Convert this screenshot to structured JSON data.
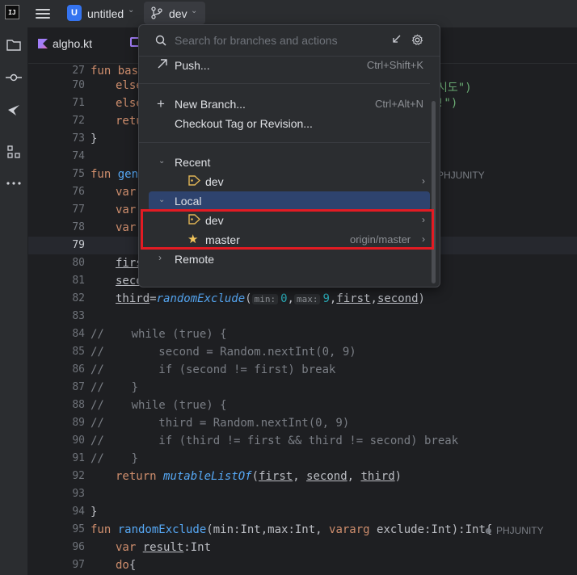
{
  "titlebar": {
    "project_badge": "U",
    "project_name": "untitled",
    "vcs_branch": "dev"
  },
  "tab": {
    "file_name": "algho.kt"
  },
  "gutter": [
    "27",
    "70",
    "71",
    "72",
    "73",
    "74",
    "75",
    "76",
    "77",
    "78",
    "79",
    "80",
    "81",
    "82",
    "83",
    "84",
    "85",
    "86",
    "87",
    "88",
    "89",
    "90",
    "91",
    "92",
    "93",
    "94",
    "95",
    "96",
    "97"
  ],
  "code": {
    "l27": "fun base",
    "l70_kw": "else",
    "l70_str": "시도\")",
    "l71_kw": "else",
    "l71_str": "!\")",
    "l72": "retu",
    "l73": "}",
    "l75_kw": "fun ",
    "l75_fn": "gene",
    "l75_author": "PHJUNITY",
    "l76": "var",
    "l77": "var",
    "l78": "var",
    "l80": "firs",
    "l81": "seco",
    "l82_a": "third",
    "l82_b": "=",
    "l82_fn": "randomExclude",
    "l82_c": "(",
    "l82_hint1": "min:",
    "l82_n1": "0",
    "l82_d": ",",
    "l82_hint2": "max:",
    "l82_n2": "9",
    "l82_e": ",",
    "l82_f": "first",
    "l82_g": ",",
    "l82_h": "second",
    "l82_i": ")",
    "l84": "//    while (true) {",
    "l85": "//        second = Random.nextInt(0, 9)",
    "l86": "//        if (second != first) break",
    "l87": "//    }",
    "l88": "//    while (true) {",
    "l89": "//        third = Random.nextInt(0, 9)",
    "l90": "//        if (third != first && third != second) break",
    "l91": "//    }",
    "l92_kw": "return ",
    "l92_fn": "mutableListOf",
    "l92_a": "(",
    "l92_b": "first",
    "l92_c": ", ",
    "l92_d": "second",
    "l92_e": ", ",
    "l92_f": "third",
    "l92_g": ")",
    "l94": "}",
    "l95_kw": "fun ",
    "l95_fn": "randomExclude",
    "l95_a": "(min:Int,max:Int, ",
    "l95_kw2": "vararg",
    "l95_b": " exclude:Int):Int{",
    "l95_author": "PHJUNITY",
    "l96_kw": "var ",
    "l96_a": "result",
    "l96_b": ":Int",
    "l97_kw": "do",
    "l97_a": "{"
  },
  "popup": {
    "search_placeholder": "Search for branches and actions",
    "push_label": "Push...",
    "push_shortcut": "Ctrl+Shift+K",
    "new_branch_label": "New Branch...",
    "new_branch_shortcut": "Ctrl+Alt+N",
    "checkout_label": "Checkout Tag or Revision...",
    "recent_header": "Recent",
    "recent_dev": "dev",
    "local_header": "Local",
    "local_dev": "dev",
    "local_master": "master",
    "local_master_tracking": "origin/master",
    "remote_header": "Remote"
  },
  "colors": {
    "accent": "#3574f0",
    "selection": "#2e436e",
    "highlight_box": "#e31b23",
    "star": "#f2c55c",
    "tag": "#e0b455"
  }
}
